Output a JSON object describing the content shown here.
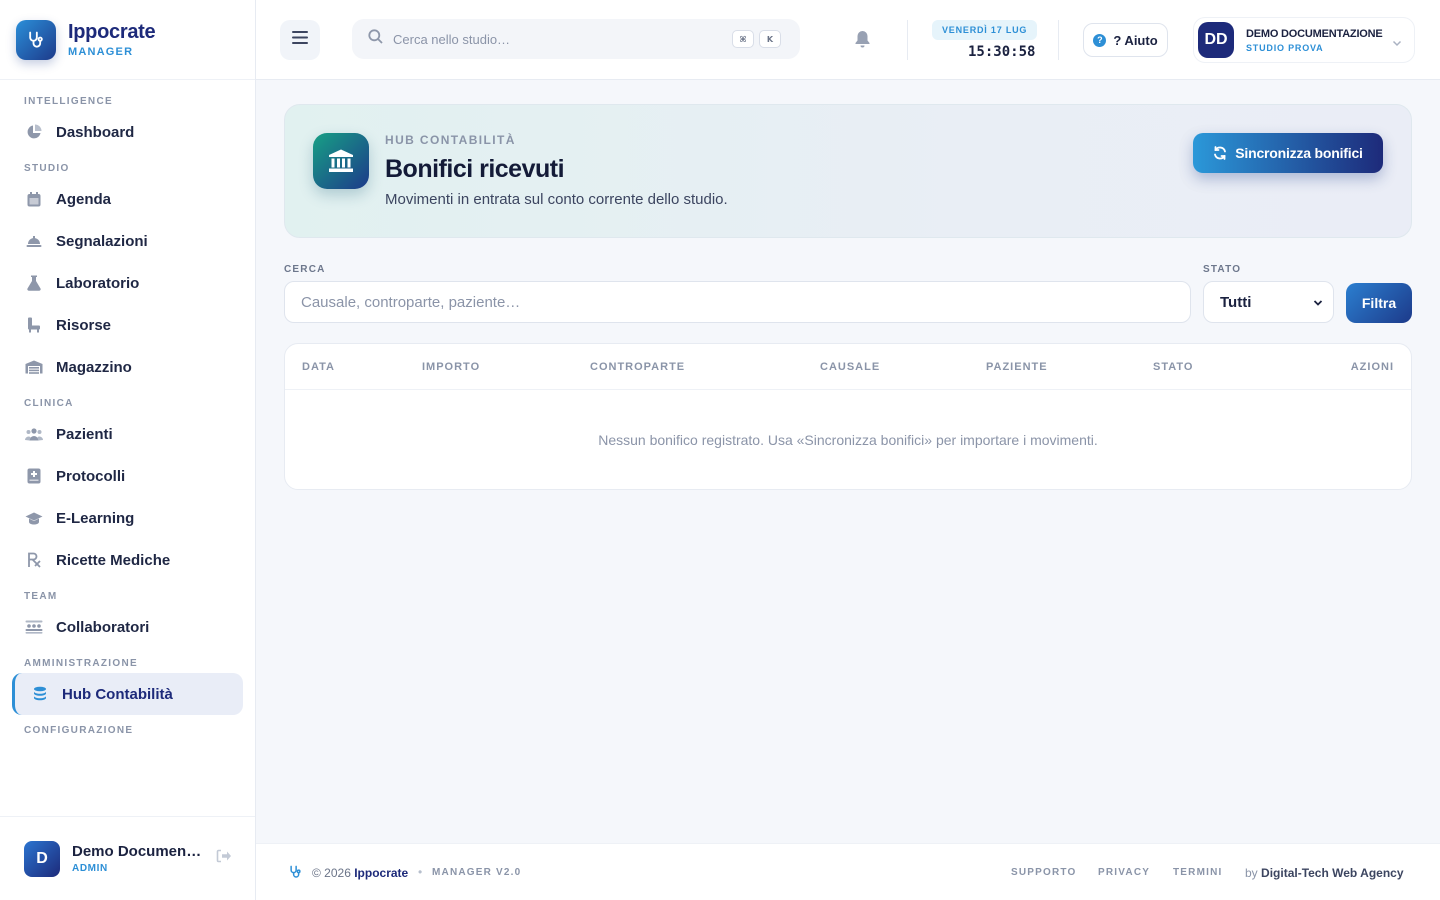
{
  "brand": {
    "name": "Ippocrate",
    "subtitle": "MANAGER"
  },
  "sidebar": {
    "sections": [
      {
        "title": "INTELLIGENCE",
        "items": [
          {
            "label": "Dashboard",
            "icon": "pie-chart-icon"
          }
        ]
      },
      {
        "title": "STUDIO",
        "items": [
          {
            "label": "Agenda",
            "icon": "calendar-icon"
          },
          {
            "label": "Segnalazioni",
            "icon": "bell-service-icon"
          },
          {
            "label": "Laboratorio",
            "icon": "flask-icon"
          },
          {
            "label": "Risorse",
            "icon": "chair-icon"
          },
          {
            "label": "Magazzino",
            "icon": "warehouse-icon"
          }
        ]
      },
      {
        "title": "CLINICA",
        "items": [
          {
            "label": "Pazienti",
            "icon": "users-icon"
          },
          {
            "label": "Protocolli",
            "icon": "medical-book-icon"
          },
          {
            "label": "E-Learning",
            "icon": "graduation-cap-icon"
          },
          {
            "label": "Ricette Mediche",
            "icon": "prescription-icon"
          }
        ]
      },
      {
        "title": "TEAM",
        "items": [
          {
            "label": "Collaboratori",
            "icon": "people-group-icon"
          }
        ]
      },
      {
        "title": "AMMINISTRAZIONE",
        "items": [
          {
            "label": "Hub Contabilità",
            "icon": "coins-icon",
            "active": true
          }
        ]
      },
      {
        "title": "CONFIGURAZIONE",
        "items": []
      }
    ],
    "user": {
      "initial": "D",
      "name": "Demo Documentazione",
      "role": "ADMIN"
    }
  },
  "topbar": {
    "search_placeholder": "Cerca nello studio…",
    "shortcut_keys": [
      "⌘",
      "K"
    ],
    "date": "VENERDÌ 17 LUG",
    "time": "15:30:58",
    "help_label": "? Aiuto",
    "profile": {
      "initials": "DD",
      "name": "DEMO DOCUMENTAZIONE",
      "studio": "STUDIO PROVA"
    }
  },
  "hero": {
    "eyebrow": "HUB CONTABILITÀ",
    "title": "Bonifici ricevuti",
    "subtitle": "Movimenti in entrata sul conto corrente dello studio.",
    "sync_button": "Sincronizza bonifici"
  },
  "filters": {
    "search_label": "CERCA",
    "search_placeholder": "Causale, controparte, paziente…",
    "status_label": "STATO",
    "status_value": "Tutti",
    "filter_button": "Filtra"
  },
  "table": {
    "columns": [
      "DATA",
      "IMPORTO",
      "CONTROPARTE",
      "CAUSALE",
      "PAZIENTE",
      "STATO",
      "AZIONI"
    ],
    "empty_message": "Nessun bonifico registrato. Usa «Sincronizza bonifici» per importare i movimenti."
  },
  "footer": {
    "copyright": "© 2026",
    "brand": "Ippocrate",
    "version": "MANAGER V2.0",
    "links": [
      "SUPPORTO",
      "PRIVACY",
      "TERMINI"
    ],
    "by_prefix": "by",
    "agency": "Digital-Tech Web Agency"
  },
  "colors": {
    "brand_navy": "#1d2a7a",
    "accent_blue": "#2d8fd6",
    "teal": "#17a085"
  }
}
